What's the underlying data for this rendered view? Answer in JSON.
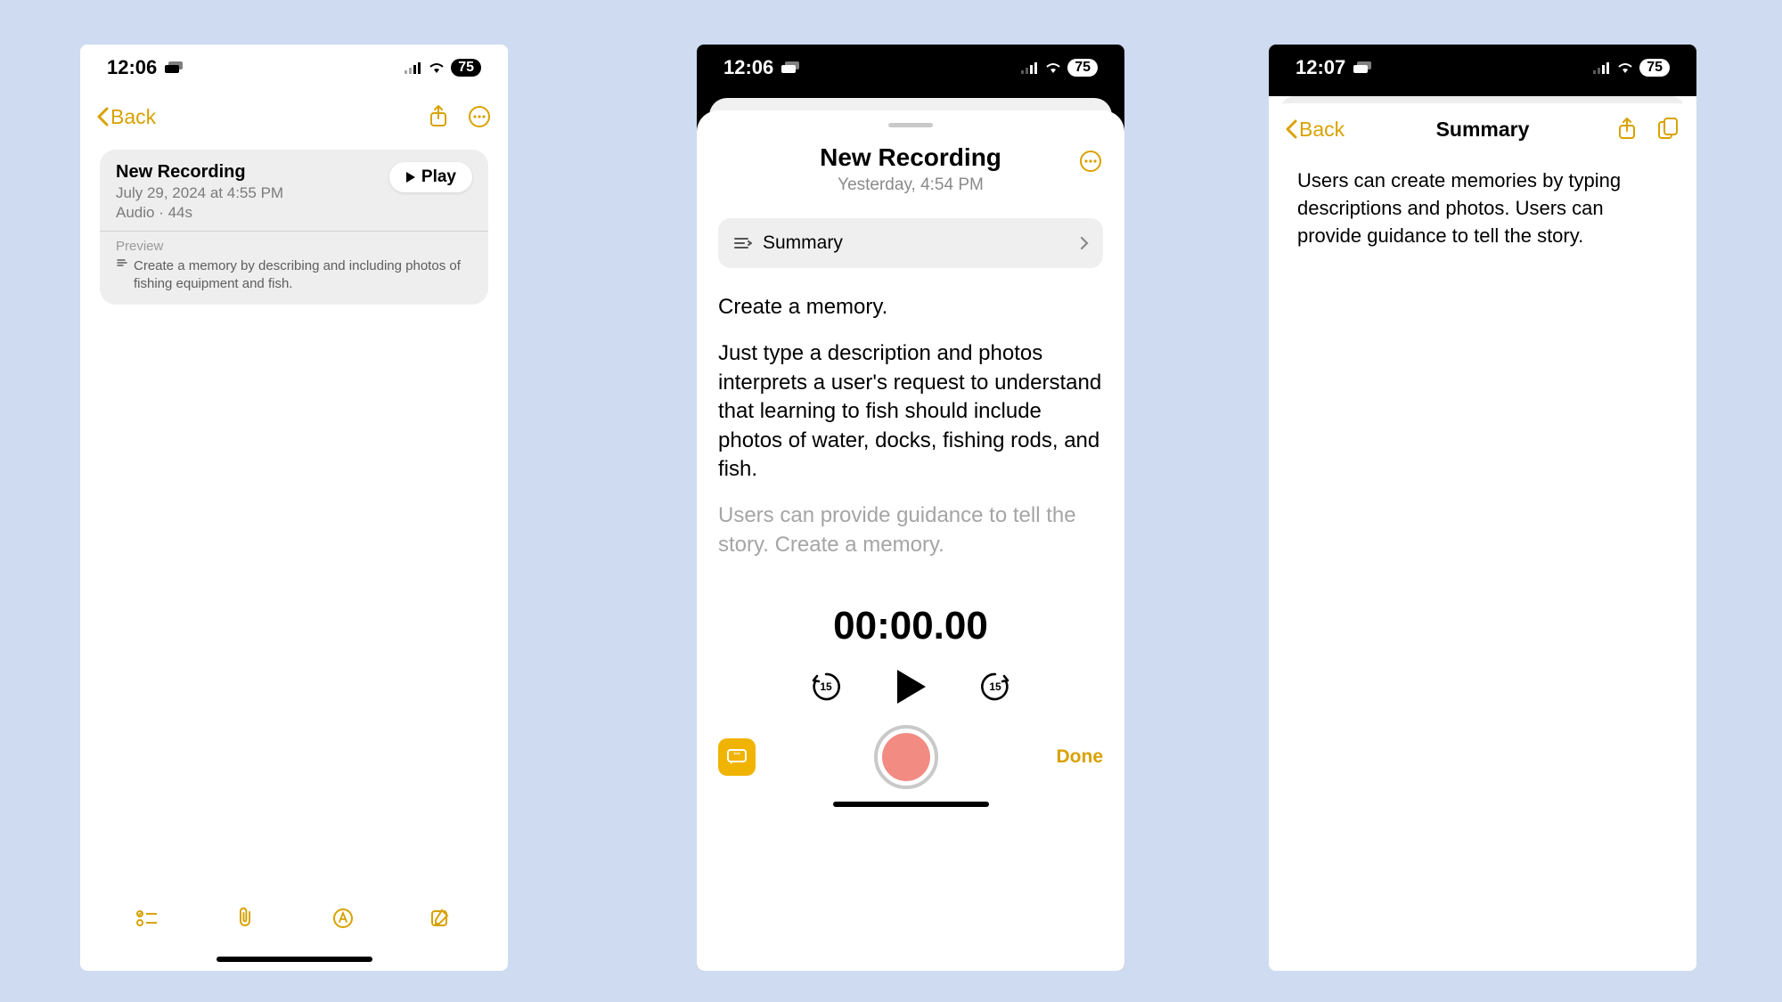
{
  "accent": "#d8a200",
  "phones": {
    "p1": {
      "status": {
        "time": "12:06",
        "battery": "75"
      },
      "nav": {
        "back": "Back"
      },
      "card": {
        "title": "New Recording",
        "date": "July 29, 2024 at 4:55 PM",
        "meta": "Audio · 44s",
        "play": "Play",
        "preview_label": "Preview",
        "preview_text": "Create a memory by describing and including photos of fishing equipment and fish."
      }
    },
    "p2": {
      "status": {
        "time": "12:06",
        "battery": "75"
      },
      "sheet": {
        "title": "New Recording",
        "subtitle": "Yesterday, 4:54 PM",
        "summary_label": "Summary",
        "transcript_p1": "Create a memory.",
        "transcript_p2": "Just type a description and photos interprets a user's request to understand that learning to fish should include photos of water, docks, fishing rods, and fish.",
        "transcript_p3": "Users can provide guidance to tell the story. Create a memory.",
        "time": "00:00.00",
        "skip_back": "15",
        "skip_fwd": "15",
        "done": "Done"
      }
    },
    "p3": {
      "status": {
        "time": "12:07",
        "battery": "75"
      },
      "nav": {
        "back": "Back",
        "title": "Summary"
      },
      "body": "Users can create memories by typing descriptions and photos. Users can provide guidance to tell the story."
    }
  }
}
